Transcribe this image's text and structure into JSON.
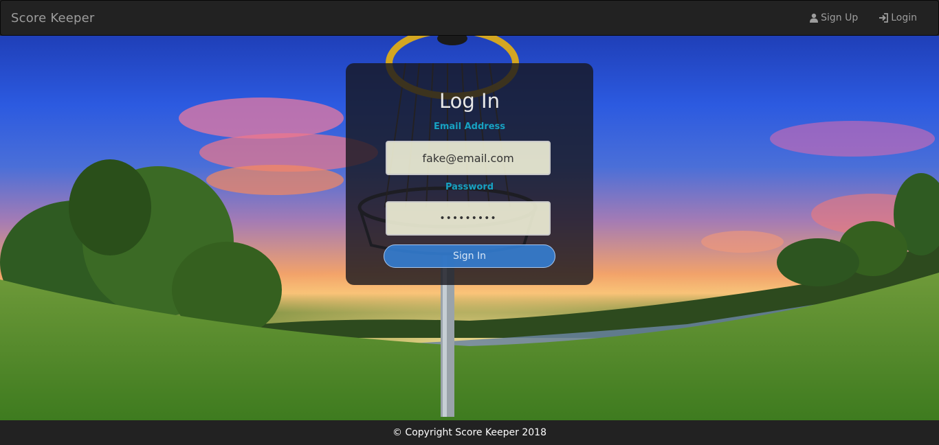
{
  "navbar": {
    "brand": "Score Keeper",
    "signup_label": "Sign Up",
    "login_label": "Login"
  },
  "login_card": {
    "title": "Log In",
    "email_label": "Email Address",
    "email_value": "fake@email.com",
    "password_label": "Password",
    "password_value": "•••••••••",
    "signin_label": "Sign In"
  },
  "footer": {
    "copyright": "© Copyright Score Keeper 2018"
  },
  "icons": {
    "signup": "user-icon",
    "login": "login-icon"
  },
  "colors": {
    "navbar_bg": "#222222",
    "nav_text": "#9d9d9d",
    "accent_label": "#17a2c2",
    "button": "#3482dc"
  }
}
